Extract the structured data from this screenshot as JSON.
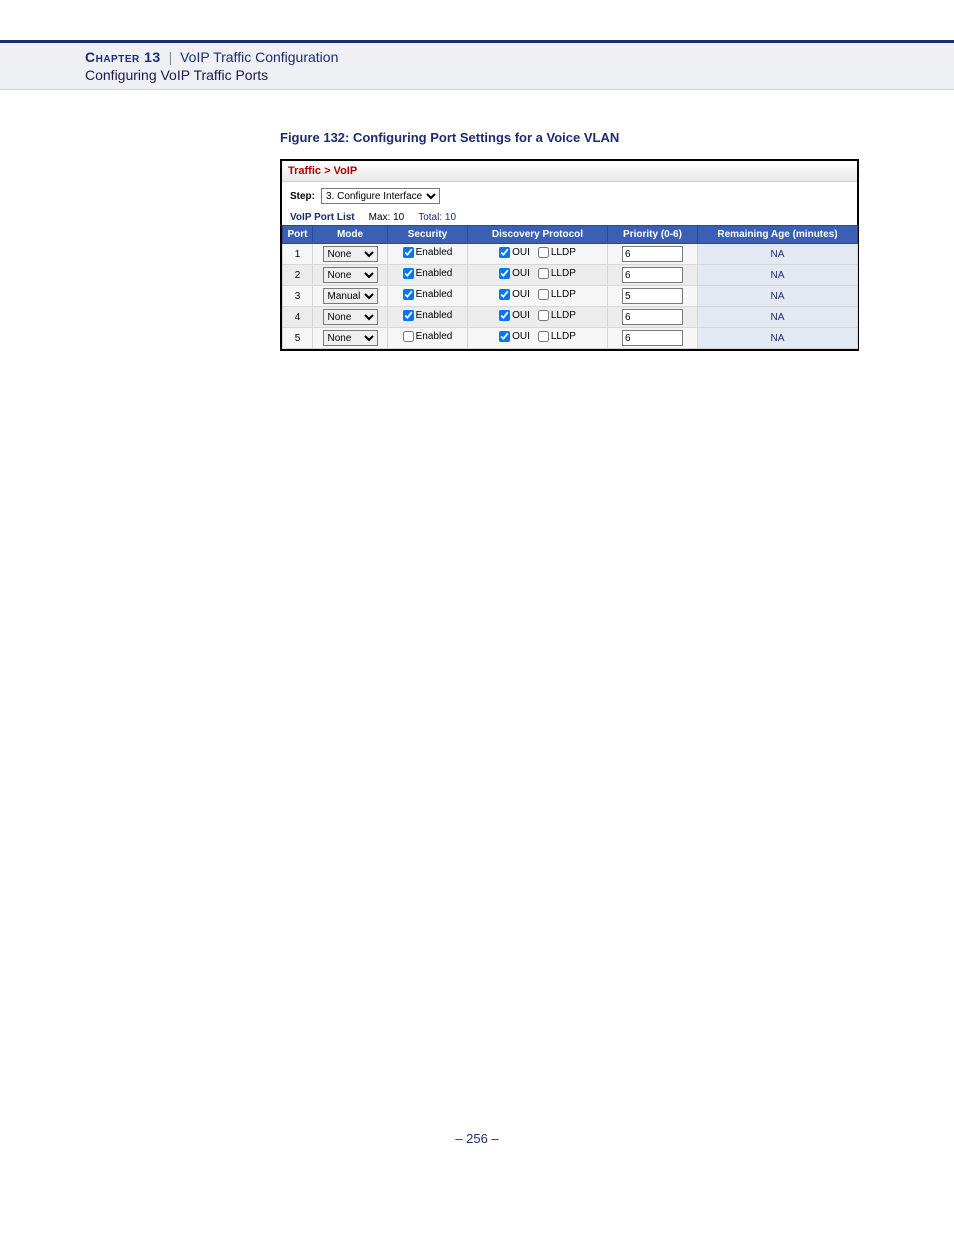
{
  "header": {
    "chapter": "Chapter 13",
    "sep": "|",
    "title": "VoIP Traffic Configuration",
    "subtitle": "Configuring VoIP Traffic Ports"
  },
  "figure": {
    "caption": "Figure 132:  Configuring Port Settings for a Voice VLAN"
  },
  "app": {
    "breadcrumb": "Traffic > VoIP",
    "step_label": "Step:",
    "step_value": "3. Configure Interface",
    "list_label": "VoIP Port List",
    "max_label": "Max: 10",
    "total_label": "Total: 10",
    "columns": {
      "port": "Port",
      "mode": "Mode",
      "security": "Security",
      "discovery": "Discovery Protocol",
      "priority": "Priority (0-6)",
      "remaining": "Remaining Age (minutes)"
    },
    "labels": {
      "enabled": "Enabled",
      "oui": "OUI",
      "lldp": "LLDP"
    },
    "rows": [
      {
        "port": "1",
        "mode": "None",
        "sec_enabled": true,
        "oui": true,
        "lldp": false,
        "priority": "6",
        "remaining": "NA"
      },
      {
        "port": "2",
        "mode": "None",
        "sec_enabled": true,
        "oui": true,
        "lldp": false,
        "priority": "6",
        "remaining": "NA"
      },
      {
        "port": "3",
        "mode": "Manual",
        "sec_enabled": true,
        "oui": true,
        "lldp": false,
        "priority": "5",
        "remaining": "NA"
      },
      {
        "port": "4",
        "mode": "None",
        "sec_enabled": true,
        "oui": true,
        "lldp": false,
        "priority": "6",
        "remaining": "NA"
      },
      {
        "port": "5",
        "mode": "None",
        "sec_enabled": false,
        "oui": true,
        "lldp": false,
        "priority": "6",
        "remaining": "NA"
      }
    ]
  },
  "footer": {
    "page": "–  256  –"
  }
}
